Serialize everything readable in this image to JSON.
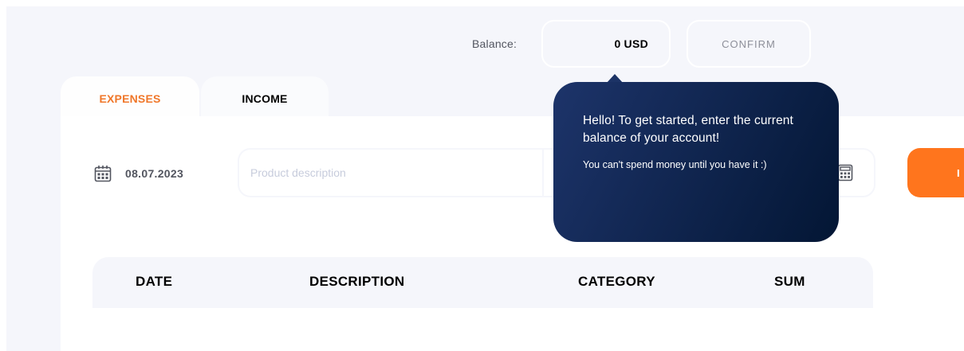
{
  "balance": {
    "label": "Balance:",
    "value": "0",
    "currency": "USD",
    "confirm_label": "CONFIRM"
  },
  "tabs": [
    {
      "label": "EXPENSES",
      "active": true
    },
    {
      "label": "INCOME",
      "active": false
    }
  ],
  "form": {
    "date": "08.07.2023",
    "description_placeholder": "Product description",
    "input_label": "I"
  },
  "table": {
    "columns": [
      "DATE",
      "DESCRIPTION",
      "CATEGORY",
      "SUM"
    ]
  },
  "tooltip": {
    "title": "Hello! To get started, enter the current balance of your account!",
    "note": "You can't spend money until you have it :)"
  },
  "colors": {
    "accent": "#ff751d",
    "active_tab_text": "#f0772a",
    "tooltip_bg_start": "#1d346a",
    "tooltip_bg_end": "#031634",
    "page_bg": "#f5f6fb"
  },
  "icons": {
    "date": "calendar-icon",
    "sum": "calculator-icon"
  }
}
